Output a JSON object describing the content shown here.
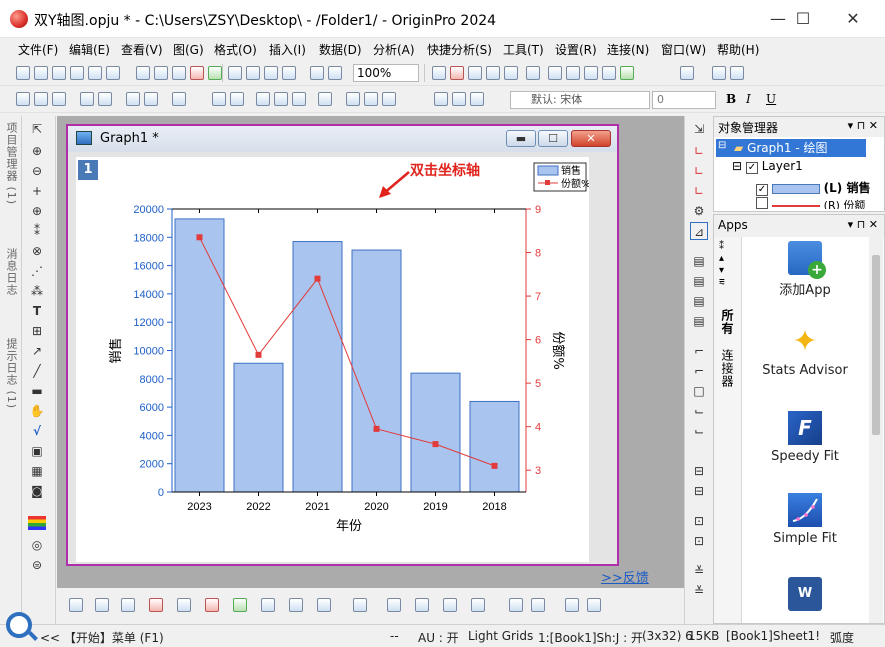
{
  "window": {
    "title": "双Y轴图.opju * - C:\\Users\\ZSY\\Desktop\\ - /Folder1/ - OriginPro 2024",
    "min": "—",
    "max": "☐",
    "close": "✕"
  },
  "menu": [
    "文件(F)",
    "编辑(E)",
    "查看(V)",
    "图(G)",
    "格式(O)",
    "插入(I)",
    "数据(D)",
    "分析(A)",
    "快捷分析(S)",
    "工具(T)",
    "设置(R)",
    "连接(N)",
    "窗口(W)",
    "帮助(H)"
  ],
  "toolbar": {
    "zoom": "100%",
    "font": "默认: 宋体",
    "size": "0",
    "bold": "B",
    "italic": "I",
    "underline": "U"
  },
  "left_tabs": [
    "项目管理器 (1)",
    "消息日志",
    "提示日志 (1)"
  ],
  "graph": {
    "title": "Graph1 *",
    "layer": "1",
    "annotation": "双击坐标轴",
    "feedback": ">>反馈"
  },
  "chart_data": {
    "type": "bar",
    "categories": [
      "2023",
      "2022",
      "2021",
      "2020",
      "2019",
      "2018"
    ],
    "series": [
      {
        "name": "销售",
        "type": "bar",
        "axis": "left",
        "values": [
          19300,
          9100,
          17700,
          17100,
          8400,
          6400
        ],
        "color": "#a9c4ee"
      },
      {
        "name": "份额%",
        "type": "line",
        "axis": "right",
        "values": [
          8.35,
          5.65,
          7.4,
          3.95,
          3.6,
          3.1
        ],
        "color": "#e23b3b"
      }
    ],
    "xlabel": "年份",
    "ylabel": "销售",
    "y2label": "份额%",
    "ylim": [
      0,
      20000
    ],
    "y2lim": [
      2.5,
      9
    ],
    "yticks": [
      0,
      2000,
      4000,
      6000,
      8000,
      10000,
      12000,
      14000,
      16000,
      18000,
      20000
    ],
    "y2ticks": [
      3,
      4,
      5,
      6,
      7,
      8,
      9
    ],
    "legend": "top-right",
    "grid": false
  },
  "object_manager": {
    "title": "对象管理器",
    "items": [
      "Graph1 - 绘图",
      "Layer1",
      "(L) 销售",
      "(R) 份额"
    ]
  },
  "apps": {
    "title": "Apps",
    "side_tabs": [
      "所有",
      "连接器"
    ],
    "items": [
      "添加App",
      "Stats Advisor",
      "Speedy Fit",
      "Simple Fit"
    ]
  },
  "status": {
    "start": "<< 【开始】菜单 (F1)",
    "dash": "--",
    "au": "AU : 开",
    "grid": "Light Grids",
    "sheet": "1:[Book1]Sh:J : 开",
    "info": "(3x32) 6",
    "size": "15KB",
    "book": "[Book1]Sheet1!",
    "angle": "弧度"
  },
  "colors": {
    "accent": "#b02ea8",
    "bar": "#a9c4ee",
    "line": "#e23b3b",
    "axis_left": "#1f5fc8",
    "axis_right": "#e23b3b"
  }
}
